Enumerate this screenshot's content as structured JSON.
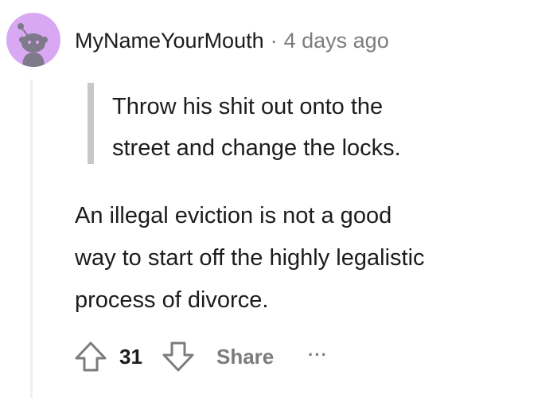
{
  "comment": {
    "username": "MyNameYourMouth",
    "separator": "·",
    "time": "4 days ago",
    "quote_lines": [
      "Throw his shit out onto the",
      "street and change the locks."
    ],
    "body_lines": [
      "An illegal eviction is not a good",
      "way to start off the highly legalistic",
      "process of divorce."
    ],
    "score": "31",
    "share_label": "Share",
    "more_label": "···"
  },
  "colors": {
    "avatar_bg": "#d9a8f2",
    "avatar_fg": "#7f7a8a",
    "text": "#1c1c1c",
    "muted": "#7c7c7c",
    "quote_bar": "#c8c8c8",
    "thread_line": "#edeff1"
  },
  "icons": {
    "upvote": "upvote-arrow-icon",
    "downvote": "downvote-arrow-icon",
    "avatar": "snoo-avatar-icon",
    "more": "ellipsis-icon"
  }
}
